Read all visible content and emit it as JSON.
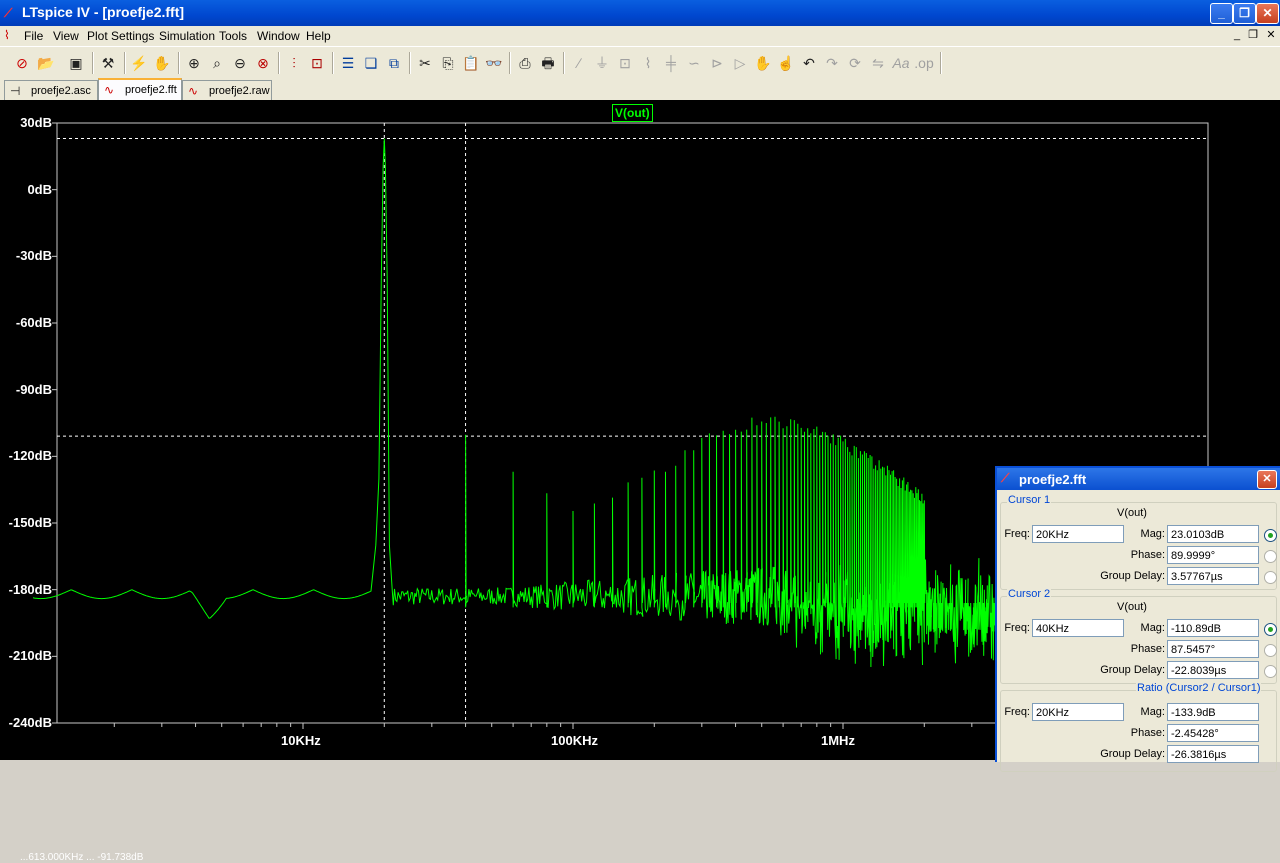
{
  "window": {
    "title": "LTspice IV - [proefje2.fft]",
    "minimize_glyph": "_",
    "maximize_glyph": "❐",
    "close_glyph": "✕"
  },
  "menu": [
    "File",
    "View",
    "Plot Settings",
    "Simulation",
    "Tools",
    "Window",
    "Help"
  ],
  "toolbar": {
    "icons": [
      "new-schematic-icon",
      "open-icon",
      "save-icon",
      "control-panel-icon",
      "run-icon",
      "halt-icon",
      "zoom-in-icon",
      "zoom-rect-icon",
      "zoom-out-icon",
      "zoom-cancel-icon",
      "autorange-icon",
      "zoom-fit-icon",
      "tile-horizontal-icon",
      "cascade-icon",
      "close-windows-icon",
      "cut-icon",
      "copy-icon",
      "paste-icon",
      "find-icon",
      "print-setup-icon",
      "print-icon",
      "wire-icon",
      "ground-icon",
      "label-icon",
      "resistor-icon",
      "capacitor-icon",
      "inductor-icon",
      "diode-icon",
      "component-icon",
      "move-icon",
      "drag-icon",
      "undo-icon",
      "redo-icon",
      "rotate-icon",
      "mirror-icon",
      "text-icon",
      "spice-directive-icon"
    ]
  },
  "tabs": [
    {
      "label": "proefje2.asc",
      "icon": "schematic-icon",
      "active": false
    },
    {
      "label": "proefje2.fft",
      "icon": "waveform-icon",
      "active": true
    },
    {
      "label": "proefje2.raw",
      "icon": "waveform-icon",
      "active": false
    }
  ],
  "plot": {
    "trace_label": "V(out)",
    "trace_color": "#00ff00",
    "background": "#000000",
    "cursor_readout": "...613.000KHz ... -91.738dB"
  },
  "chart_data": {
    "type": "line",
    "title": "",
    "xscale": "log",
    "x_tick_labels": [
      "10KHz",
      "100KHz",
      "1MHz"
    ],
    "y_tick_labels": [
      "30dB",
      "0dB",
      "-30dB",
      "-60dB",
      "-90dB",
      "-120dB",
      "-150dB",
      "-180dB",
      "-210dB",
      "-240dB"
    ],
    "ylim": [
      -240,
      30
    ],
    "xlim_hz": [
      1000,
      5000000
    ],
    "series": [
      {
        "name": "V(out)",
        "fundamental_hz": 20000,
        "fundamental_db": 23,
        "noise_floor_db": -180,
        "harmonics": [
          {
            "freq_hz": 40000,
            "db": -111
          },
          {
            "freq_hz": 60000,
            "db": -124
          },
          {
            "freq_hz": 80000,
            "db": -137
          },
          {
            "freq_hz": 100000,
            "db": -143
          },
          {
            "freq_hz": 200000,
            "db": -128
          },
          {
            "freq_hz": 300000,
            "db": -114
          },
          {
            "freq_hz": 400000,
            "db": -107
          },
          {
            "freq_hz": 500000,
            "db": -103
          },
          {
            "freq_hz": 700000,
            "db": -106
          },
          {
            "freq_hz": 1000000,
            "db": -114
          },
          {
            "freq_hz": 1500000,
            "db": -128
          },
          {
            "freq_hz": 2000000,
            "db": -139
          }
        ]
      }
    ],
    "cursors": [
      {
        "freq_hz": 20000,
        "db": 23.0103
      },
      {
        "freq_hz": 40000,
        "db": -110.89
      }
    ]
  },
  "dialog": {
    "title": "proefje2.fft",
    "cursor1": {
      "legend": "Cursor 1",
      "trace": "V(out)",
      "freq_label": "Freq:",
      "freq": "20KHz",
      "mag_label": "Mag:",
      "mag": "23.0103dB",
      "phase_label": "Phase:",
      "phase": "89.9999°",
      "gd_label": "Group Delay:",
      "gd": "3.57767µs"
    },
    "cursor2": {
      "legend": "Cursor 2",
      "trace": "V(out)",
      "freq_label": "Freq:",
      "freq": "40KHz",
      "mag_label": "Mag:",
      "mag": "-110.89dB",
      "phase_label": "Phase:",
      "phase": "87.5457°",
      "gd_label": "Group Delay:",
      "gd": "-22.8039µs"
    },
    "ratio": {
      "legend": "Ratio (Cursor2 / Cursor1)",
      "freq_label": "Freq:",
      "freq": "20KHz",
      "mag_label": "Mag:",
      "mag": "-133.9dB",
      "phase_label": "Phase:",
      "phase": "-2.45428°",
      "gd_label": "Group Delay:",
      "gd": "-26.3816µs"
    }
  }
}
